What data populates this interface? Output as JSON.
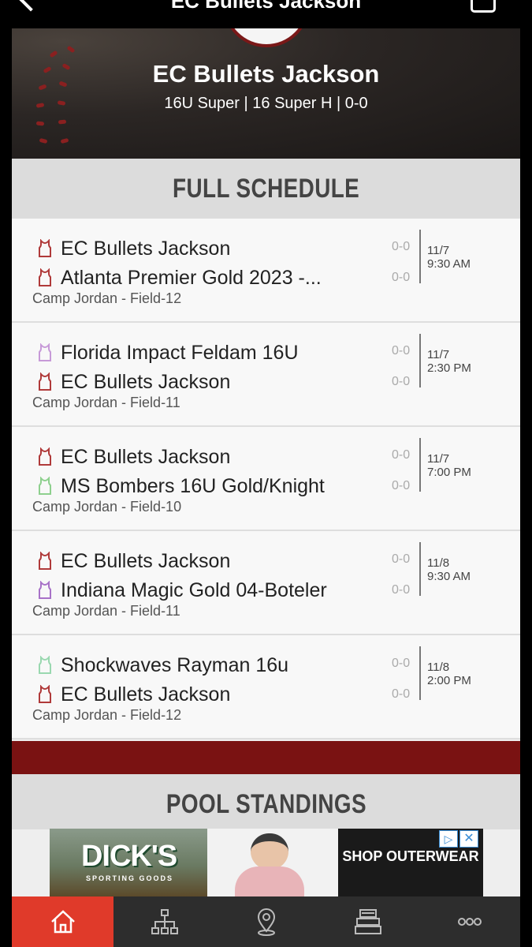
{
  "header": {
    "title": "EC Bullets Jackson"
  },
  "hero": {
    "team_name": "EC Bullets Jackson",
    "subtitle": "16U Super | 16 Super H | 0-0"
  },
  "schedule": {
    "title": "FULL SCHEDULE",
    "games": [
      {
        "team1": {
          "name": "EC Bullets Jackson",
          "score": "0-0",
          "jersey_color": "#b03a3a"
        },
        "team2": {
          "name": "Atlanta Premier Gold 2023 -...",
          "score": "0-0",
          "jersey_color": "#b03a3a"
        },
        "location": "Camp Jordan - Field-12",
        "date": "11/7",
        "time": "9:30 AM"
      },
      {
        "team1": {
          "name": "Florida Impact Feldam 16U",
          "score": "0-0",
          "jersey_color": "#c79ad8"
        },
        "team2": {
          "name": "EC Bullets Jackson",
          "score": "0-0",
          "jersey_color": "#b03a3a"
        },
        "location": "Camp Jordan - Field-11",
        "date": "11/7",
        "time": "2:30 PM"
      },
      {
        "team1": {
          "name": "EC Bullets Jackson",
          "score": "0-0",
          "jersey_color": "#b03a3a"
        },
        "team2": {
          "name": "MS Bombers 16U Gold/Knight",
          "score": "0-0",
          "jersey_color": "#8ed08e"
        },
        "location": "Camp Jordan - Field-10",
        "date": "11/7",
        "time": "7:00 PM"
      },
      {
        "team1": {
          "name": "EC Bullets Jackson",
          "score": "0-0",
          "jersey_color": "#b03a3a"
        },
        "team2": {
          "name": "Indiana Magic Gold 04-Boteler",
          "score": "0-0",
          "jersey_color": "#a872c8"
        },
        "location": "Camp Jordan - Field-11",
        "date": "11/8",
        "time": "9:30 AM"
      },
      {
        "team1": {
          "name": "Shockwaves Rayman 16u",
          "score": "0-0",
          "jersey_color": "#9ad8b0"
        },
        "team2": {
          "name": "EC Bullets Jackson",
          "score": "0-0",
          "jersey_color": "#b03a3a"
        },
        "location": "Camp Jordan - Field-12",
        "date": "11/8",
        "time": "2:00 PM"
      }
    ]
  },
  "standings": {
    "title": "POOL STANDINGS"
  },
  "ad": {
    "brand": "DICK'S",
    "brand_sub": "SPORTING GOODS",
    "cta": "SHOP OUTERWEAR"
  },
  "bottom_nav": [
    {
      "icon": "home-icon",
      "active": true
    },
    {
      "icon": "bracket-icon",
      "active": false
    },
    {
      "icon": "location-pin-icon",
      "active": false
    },
    {
      "icon": "stack-icon",
      "active": false
    },
    {
      "icon": "more-icon",
      "active": false
    }
  ],
  "colors": {
    "accent": "#e03a2a",
    "dark_red": "#7a1212"
  }
}
